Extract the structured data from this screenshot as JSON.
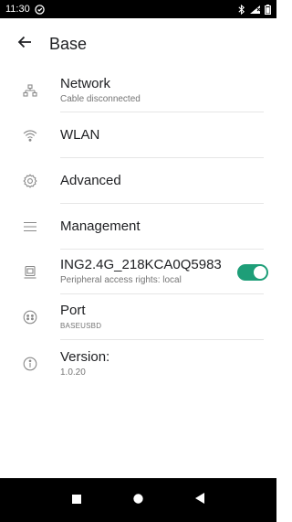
{
  "status_bar": {
    "time": "11:30",
    "icons": [
      "vpn-icon",
      "bluetooth-icon",
      "signal-icon",
      "battery-icon"
    ]
  },
  "app_bar": {
    "title": "Base",
    "back_icon": "arrow-back-icon"
  },
  "items": [
    {
      "id": "network",
      "icon": "network-icon",
      "title": "Network",
      "subtitle": "Cable disconnected"
    },
    {
      "id": "wlan",
      "icon": "wifi-icon",
      "title": "WLAN",
      "subtitle": ""
    },
    {
      "id": "advanced",
      "icon": "gear-icon",
      "title": "Advanced",
      "subtitle": ""
    },
    {
      "id": "management",
      "icon": "menu-icon",
      "title": "Management",
      "subtitle": ""
    },
    {
      "id": "peripheral",
      "icon": "device-icon",
      "title": "ING2.4G_218KCA0Q5983",
      "subtitle": "Peripheral access rights: local",
      "toggle_on": true
    },
    {
      "id": "port",
      "icon": "port-icon",
      "title": "Port",
      "subtitle": "BASEUSBD"
    },
    {
      "id": "version",
      "icon": "info-icon",
      "title": "Version:",
      "subtitle": "1.0.20"
    }
  ],
  "colors": {
    "accent": "#1e9e78",
    "icon_gray": "#8a8a8a",
    "divider": "#e6e6e6"
  },
  "nav_bar": {
    "buttons": [
      "recents-icon",
      "home-icon",
      "back-triangle-icon"
    ]
  }
}
